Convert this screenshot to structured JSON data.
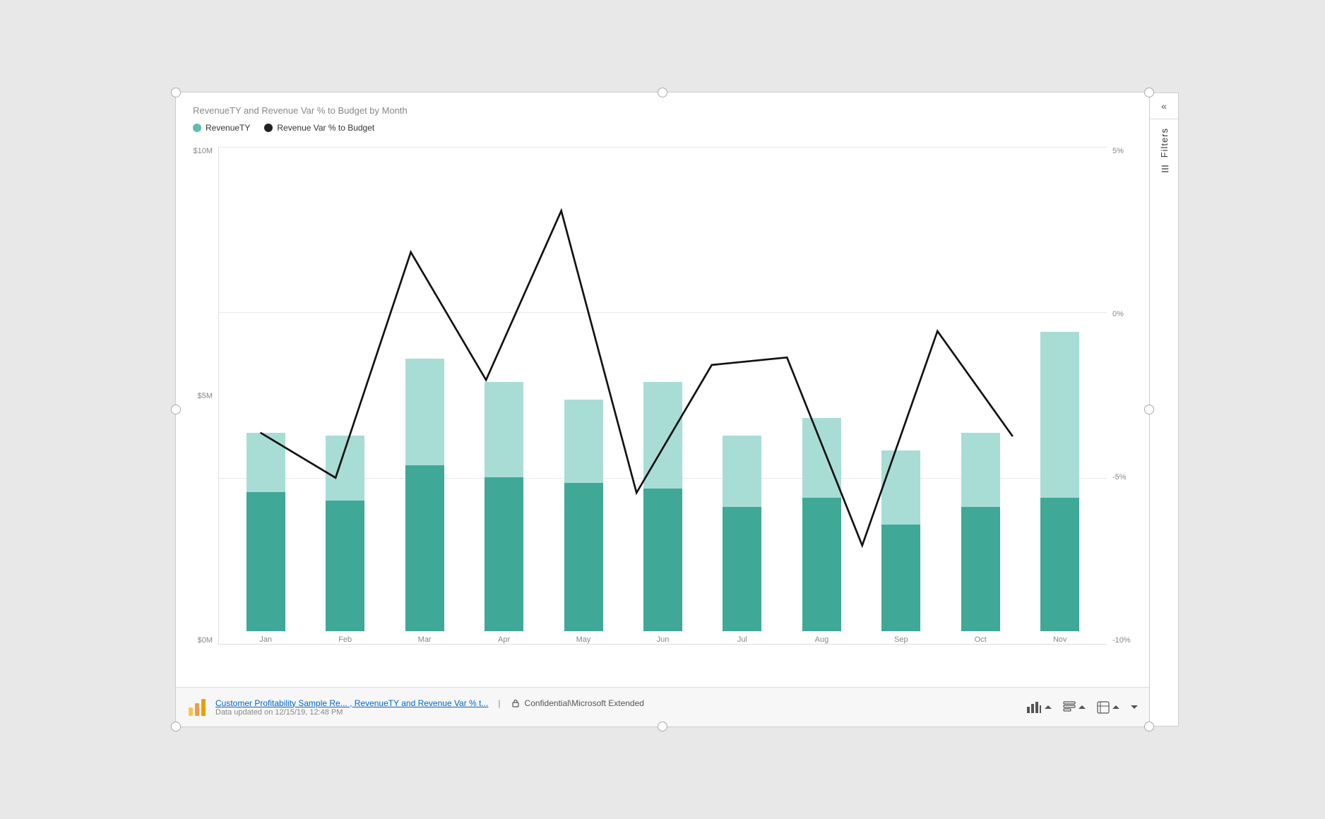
{
  "chart": {
    "title": "RevenueTY and Revenue Var % to Budget by Month",
    "legend": [
      {
        "id": "revenue-ty",
        "label": "RevenueTY",
        "color": "#5dbfad",
        "type": "circle"
      },
      {
        "id": "revenue-var",
        "label": "Revenue Var % to Budget",
        "color": "#222222",
        "type": "circle"
      }
    ],
    "y_axis_left": [
      "$10M",
      "$5M",
      "$0M"
    ],
    "y_axis_right": [
      "5%",
      "0%",
      "-5%",
      "-10%"
    ],
    "months": [
      "Jan",
      "Feb",
      "Mar",
      "Apr",
      "May",
      "Jun",
      "Jul",
      "Aug",
      "Sep",
      "Oct",
      "Nov"
    ],
    "bars": [
      {
        "month": "Jan",
        "bottom_pct": 47,
        "top_pct": 20
      },
      {
        "month": "Feb",
        "bottom_pct": 44,
        "top_pct": 22
      },
      {
        "month": "Mar",
        "bottom_pct": 56,
        "top_pct": 36
      },
      {
        "month": "Apr",
        "bottom_pct": 52,
        "top_pct": 32
      },
      {
        "month": "May",
        "bottom_pct": 50,
        "top_pct": 28
      },
      {
        "month": "Jun",
        "bottom_pct": 48,
        "top_pct": 36
      },
      {
        "month": "Jul",
        "bottom_pct": 42,
        "top_pct": 24
      },
      {
        "month": "Aug",
        "bottom_pct": 45,
        "top_pct": 27
      },
      {
        "month": "Sep",
        "bottom_pct": 36,
        "top_pct": 25
      },
      {
        "month": "Oct",
        "bottom_pct": 42,
        "top_pct": 25
      },
      {
        "month": "Nov",
        "bottom_pct": 45,
        "top_pct": 56
      }
    ],
    "line_points": "115,68 210,82 305,25 400,52 495,12 590,90 685,55 780,50 875,88 970,48 1065,62"
  },
  "filters": {
    "label": "Filters",
    "collapse_icon": "«"
  },
  "footer": {
    "link_text": "Customer Profitability Sample Re... , RevenueTY and Revenue Var % t...",
    "separator": "|",
    "confidential": "Confidential\\Microsoft Extended",
    "updated": "Data updated on 12/15/19, 12:48 PM",
    "buttons": [
      {
        "id": "visualizations",
        "icon": "bar-chart-icon",
        "label": ""
      },
      {
        "id": "fields",
        "icon": "fields-icon",
        "label": ""
      },
      {
        "id": "format",
        "icon": "format-icon",
        "label": ""
      },
      {
        "id": "expand",
        "icon": "expand-icon",
        "label": ""
      }
    ]
  }
}
